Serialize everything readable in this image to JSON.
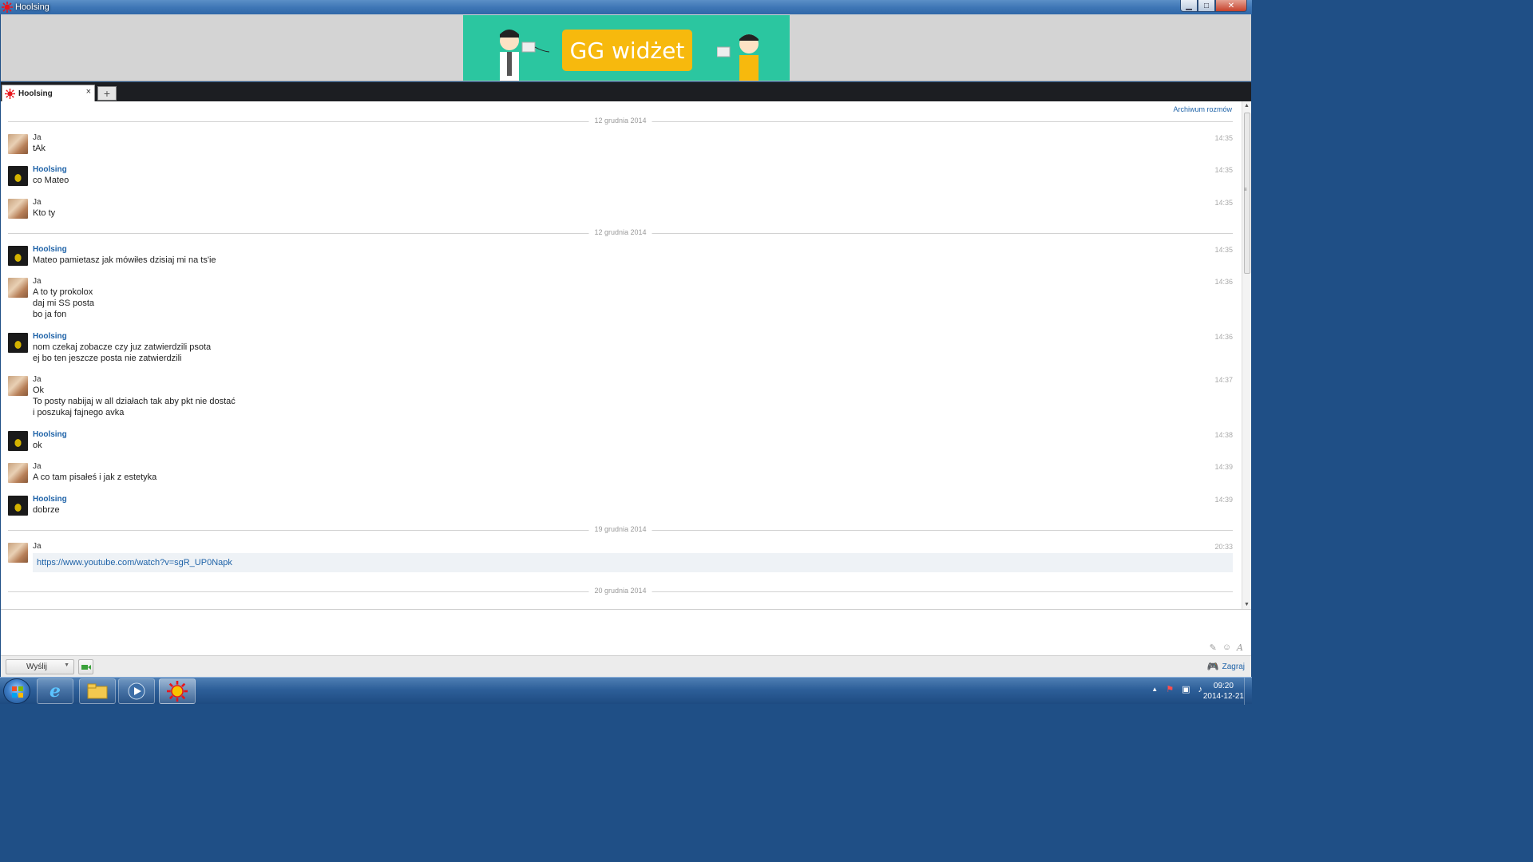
{
  "window": {
    "title": "Hoolsing"
  },
  "banner": {
    "text": "GG widżet"
  },
  "tab": {
    "label": "Hoolsing",
    "close": "×",
    "add": "+"
  },
  "chat": {
    "archive_link": "Archiwum rozmów",
    "date_separators": [
      "12 grudnia 2014",
      "12 grudnia 2014",
      "19 grudnia 2014",
      "20 grudnia 2014"
    ],
    "messages": [
      {
        "author": "Ja",
        "time": "14:35",
        "lines": [
          "tAk"
        ]
      },
      {
        "author": "Hoolsing",
        "time": "14:35",
        "lines": [
          "co Mateo"
        ]
      },
      {
        "author": "Ja",
        "time": "14:35",
        "lines": [
          "Kto ty"
        ]
      },
      {
        "author": "Hoolsing",
        "time": "14:35",
        "lines": [
          "Mateo pamietasz jak mówiłes dzisiaj mi na ts'ie"
        ]
      },
      {
        "author": "Ja",
        "time": "14:36",
        "lines": [
          "A to ty prokolox",
          "daj mi SS posta",
          "bo ja fon"
        ]
      },
      {
        "author": "Hoolsing",
        "time": "14:36",
        "lines": [
          "nom czekaj zobacze czy juz zatwierdzili psota",
          "ej bo ten jeszcze posta nie zatwierdzili"
        ]
      },
      {
        "author": "Ja",
        "time": "14:37",
        "lines": [
          "Ok",
          "To posty nabijaj w all działach tak aby pkt nie dostać",
          "i poszukaj fajnego avka"
        ]
      },
      {
        "author": "Hoolsing",
        "time": "14:38",
        "lines": [
          "ok"
        ]
      },
      {
        "author": "Ja",
        "time": "14:39",
        "lines": [
          "A co tam pisałeś i jak z estetyka"
        ]
      },
      {
        "author": "Hoolsing",
        "time": "14:39",
        "lines": [
          "dobrze"
        ]
      },
      {
        "author": "Ja",
        "time": "20:33",
        "link": "https://www.youtube.com/watch?v=sgR_UP0Napk"
      }
    ]
  },
  "bottombar": {
    "send_label": "Wyślij",
    "play_label": "Zagraj"
  },
  "taskbar": {
    "time": "09:20",
    "date": "2014-12-21"
  },
  "colors": {
    "accent": "#1f63a8",
    "banner_bg": "#2bc6a0",
    "banner_button": "#f7b90d"
  }
}
